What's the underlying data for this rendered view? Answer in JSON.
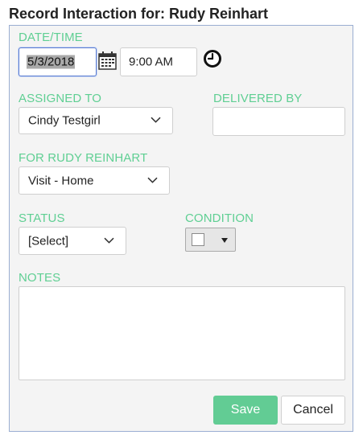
{
  "header": {
    "title": "Record Interaction for: Rudy Reinhart"
  },
  "form": {
    "datetime": {
      "label": "DATE/TIME",
      "date_value": "5/3/2018",
      "time_value": "9:00 AM",
      "calendar_icon": "calendar-icon",
      "clock_icon": "clock-icon"
    },
    "assigned_to": {
      "label": "ASSIGNED TO",
      "value": "Cindy Testgirl"
    },
    "delivered_by": {
      "label": "DELIVERED BY",
      "value": ""
    },
    "for_person": {
      "label": "FOR RUDY REINHART",
      "value": "Visit - Home"
    },
    "status": {
      "label": "STATUS",
      "value": "[Select]"
    },
    "condition": {
      "label": "CONDITION",
      "swatch_color": "#ffffff"
    },
    "notes": {
      "label": "NOTES",
      "value": ""
    }
  },
  "buttons": {
    "save_label": "Save",
    "cancel_label": "Cancel"
  },
  "colors": {
    "accent": "#5fcf93",
    "save_bg": "#62cc94",
    "panel_border": "#9aaed2"
  }
}
